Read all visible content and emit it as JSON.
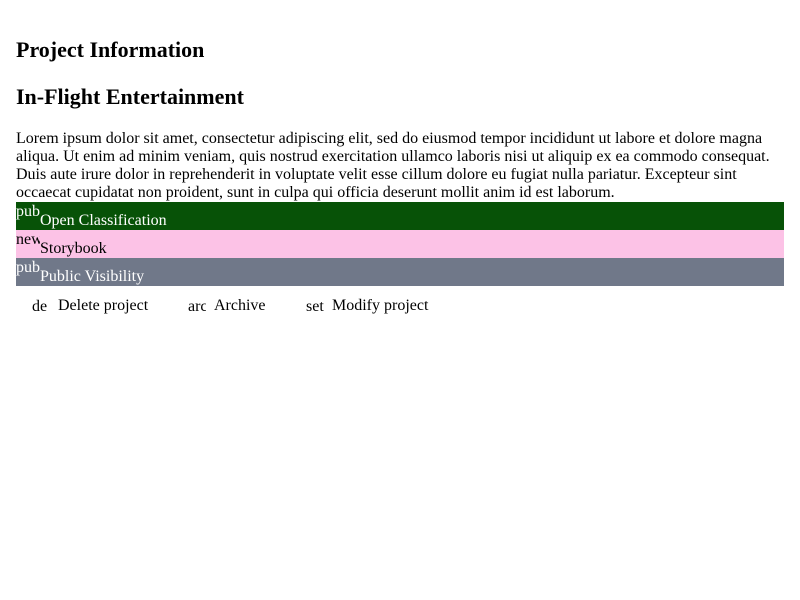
{
  "page": {
    "section_title": "Project Information",
    "project_title": "In-Flight Entertainment",
    "description": "Lorem ipsum dolor sit amet, consectetur adipiscing elit, sed do eiusmod tempor incididunt ut labore et dolore magna aliqua. Ut enim ad minim veniam, quis nostrud exercitation ullamco laboris nisi ut aliquip ex ea commodo consequat. Duis aute irure dolor in reprehenderit in voluptate velit esse cillum dolore eu fugiat nulla pariatur. Excepteur sint occaecat cupidatat non proident, sunt in culpa qui officia deserunt mollit anim id est laborum."
  },
  "tags": [
    {
      "icon_text": "pub",
      "label": "Open Classification",
      "color": "#075207"
    },
    {
      "icon_text": "new",
      "label": "Storybook",
      "color": "#fcc2e6"
    },
    {
      "icon_text": "pub",
      "label": "Public Visibility",
      "color": "#707889"
    }
  ],
  "actions": [
    {
      "icon_text": "de",
      "icon": "delete-icon",
      "label": "Delete project"
    },
    {
      "icon_text": "arc",
      "icon": "archive-icon",
      "label": "Archive"
    },
    {
      "icon_text": "set",
      "icon": "settings-icon",
      "label": "Modify project"
    }
  ]
}
